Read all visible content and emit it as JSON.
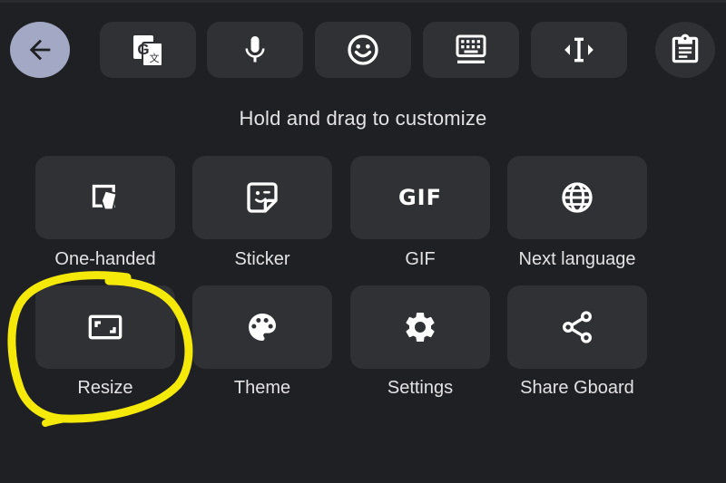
{
  "toolbar": {
    "back_icon": "arrow-left-icon",
    "buttons": [
      {
        "icon": "translate-icon"
      },
      {
        "icon": "microphone-icon"
      },
      {
        "icon": "emoji-icon"
      },
      {
        "icon": "keyboard-icon"
      },
      {
        "icon": "text-cursor-icon"
      }
    ],
    "clipboard_icon": "clipboard-icon"
  },
  "hint": "Hold and drag to customize",
  "tiles": [
    {
      "label": "One-handed",
      "icon": "one-handed-icon"
    },
    {
      "label": "Sticker",
      "icon": "sticker-icon"
    },
    {
      "label": "GIF",
      "icon": "gif-icon",
      "icon_text": "GIF"
    },
    {
      "label": "Next language",
      "icon": "globe-icon"
    },
    {
      "label": "Resize",
      "icon": "resize-icon"
    },
    {
      "label": "Theme",
      "icon": "palette-icon"
    },
    {
      "label": "Settings",
      "icon": "gear-icon"
    },
    {
      "label": "Share Gboard",
      "icon": "share-icon"
    }
  ],
  "colors": {
    "background": "#1f2023",
    "button": "#303135",
    "back_button": "#a3a9c4",
    "text": "#e3e3e6",
    "highlight_annotation": "#f5e90a"
  }
}
